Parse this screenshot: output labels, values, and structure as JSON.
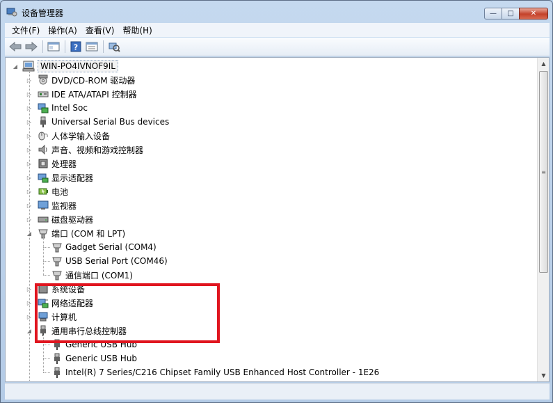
{
  "window": {
    "title": "设备管理器",
    "minimize_label": "—",
    "maximize_label": "□",
    "close_label": "✕"
  },
  "menu": [
    "文件(F)",
    "操作(A)",
    "查看(V)",
    "帮助(H)"
  ],
  "toolbar": {
    "buttons": [
      "back-icon",
      "forward-icon",
      "properties-icon",
      "help-icon",
      "view-icon",
      "scan-hardware-icon"
    ]
  },
  "tree": {
    "root": "WIN-PO4IVNOF9IL",
    "items": [
      {
        "label": "DVD/CD-ROM 驱动器",
        "icon": "dvd-drive-icon",
        "expanded": false
      },
      {
        "label": "IDE ATA/ATAPI 控制器",
        "icon": "ide-controller-icon",
        "expanded": false
      },
      {
        "label": "Intel Soc",
        "icon": "intel-soc-icon",
        "expanded": false
      },
      {
        "label": "Universal Serial Bus devices",
        "icon": "usb-plug-icon",
        "expanded": false
      },
      {
        "label": "人体学输入设备",
        "icon": "hid-icon",
        "expanded": false
      },
      {
        "label": "声音、视频和游戏控制器",
        "icon": "speaker-icon",
        "expanded": false
      },
      {
        "label": "处理器",
        "icon": "processor-icon",
        "expanded": false
      },
      {
        "label": "显示适配器",
        "icon": "display-adapter-icon",
        "expanded": false
      },
      {
        "label": "电池",
        "icon": "battery-icon",
        "expanded": false
      },
      {
        "label": "监视器",
        "icon": "monitor-icon",
        "expanded": false
      },
      {
        "label": "磁盘驱动器",
        "icon": "disk-drive-icon",
        "expanded": false
      },
      {
        "label": "端口 (COM 和 LPT)",
        "icon": "port-icon",
        "expanded": true,
        "children": [
          "Gadget Serial (COM4)",
          "USB Serial Port (COM46)",
          "通信端口 (COM1)"
        ]
      },
      {
        "label": "系统设备",
        "icon": "system-device-icon",
        "expanded": false
      },
      {
        "label": "网络适配器",
        "icon": "network-adapter-icon",
        "expanded": false
      },
      {
        "label": "计算机",
        "icon": "computer-icon",
        "expanded": false
      },
      {
        "label": "通用串行总线控制器",
        "icon": "usb-plug-icon",
        "expanded": true,
        "children": [
          "Generic USB Hub",
          "Generic USB Hub",
          "Intel(R) 7 Series/C216 Chipset Family USB Enhanced Host Controller - 1E26"
        ]
      }
    ]
  },
  "scrollbar": {
    "grip": "≡"
  },
  "colors": {
    "highlight_box": "#e0151f",
    "window_frame": "#b9d1ea"
  }
}
